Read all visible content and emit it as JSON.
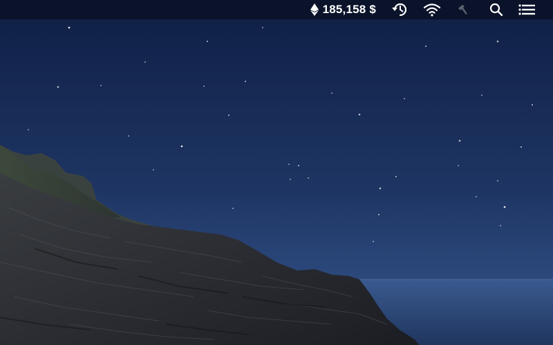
{
  "menubar": {
    "crypto_price": "185,158 $",
    "icons": [
      "ethereum-icon",
      "time-machine-icon",
      "wifi-icon",
      "hammer-icon",
      "search-icon",
      "notification-center-icon"
    ]
  },
  "colors": {
    "menubar_bg": "#0a1228",
    "sky_top": "#0f1f45",
    "sky_bottom": "#2e4a7e",
    "sea": "#2a4574",
    "rock": "#2a2c33"
  }
}
